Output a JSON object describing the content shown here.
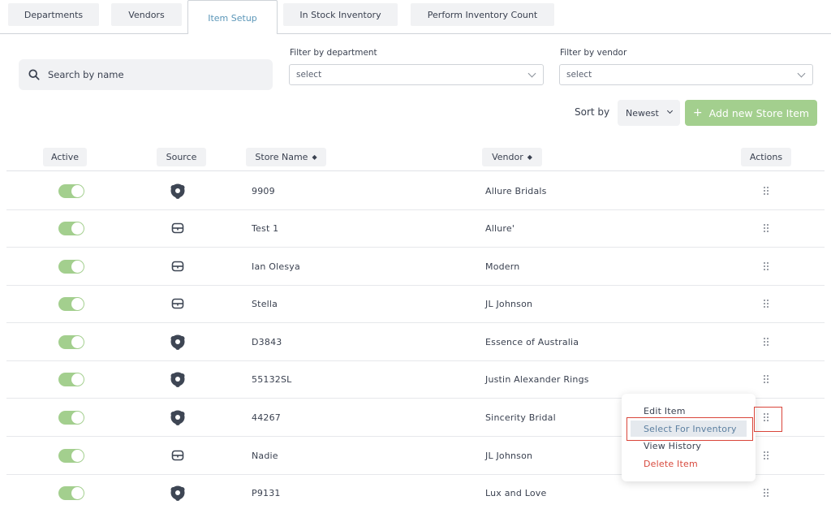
{
  "tabs": [
    {
      "label": "Departments",
      "active": false
    },
    {
      "label": "Vendors",
      "active": false
    },
    {
      "label": "Item Setup",
      "active": true
    },
    {
      "label": "In Stock Inventory",
      "active": false
    },
    {
      "label": "Perform Inventory Count",
      "active": false
    }
  ],
  "search": {
    "placeholder": "Search by name",
    "icon": "search-icon"
  },
  "filters": {
    "department": {
      "label": "Filter by department",
      "value": "select"
    },
    "vendor": {
      "label": "Filter by vendor",
      "value": "select"
    }
  },
  "sort": {
    "label": "Sort by",
    "value": "Newest"
  },
  "add_button": {
    "label": "Add new Store Item",
    "icon": "plus-icon"
  },
  "table": {
    "headers": {
      "active": "Active",
      "source": "Source",
      "store_name": "Store Name",
      "vendor": "Vendor",
      "actions": "Actions"
    },
    "rows": [
      {
        "active": true,
        "source": "brand-logo-icon",
        "store_name": "9909",
        "vendor": "Allure Bridals"
      },
      {
        "active": true,
        "source": "store-icon",
        "store_name": "Test 1",
        "vendor": "Allure'"
      },
      {
        "active": true,
        "source": "store-icon",
        "store_name": "Ian Olesya",
        "vendor": "Modern"
      },
      {
        "active": true,
        "source": "store-icon",
        "store_name": "Stella",
        "vendor": "JL Johnson"
      },
      {
        "active": true,
        "source": "brand-logo-icon",
        "store_name": "D3843",
        "vendor": "Essence of Australia"
      },
      {
        "active": true,
        "source": "brand-logo-icon",
        "store_name": "55132SL",
        "vendor": "Justin Alexander Rings"
      },
      {
        "active": true,
        "source": "brand-logo-icon",
        "store_name": "44267",
        "vendor": "Sincerity Bridal"
      },
      {
        "active": true,
        "source": "store-icon",
        "store_name": "Nadie",
        "vendor": "JL Johnson"
      },
      {
        "active": true,
        "source": "brand-logo-icon",
        "store_name": "P9131",
        "vendor": "Lux and Love"
      }
    ]
  },
  "actions_menu": {
    "items": [
      "Edit Item",
      "Select For Inventory",
      "View History",
      "Delete Item"
    ],
    "highlighted": "Select For Inventory"
  },
  "colors": {
    "accent_green": "#a3cf8e",
    "active_tab_text": "#5b96b8",
    "danger": "#d84a3e",
    "highlight_border": "#d9453a"
  }
}
